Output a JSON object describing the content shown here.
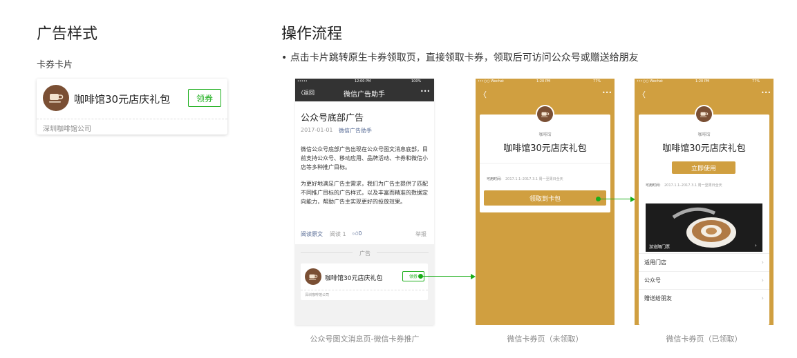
{
  "left": {
    "title": "广告样式",
    "subtitle": "卡券卡片",
    "card": {
      "name": "咖啡馆30元店庆礼包",
      "button": "领券",
      "company": "深圳咖啡馆公司"
    }
  },
  "right": {
    "title": "操作流程",
    "bullet": "•  点击卡片跳转原生卡券领取页，直接领取卡券，领取后可访问公众号或赠送给朋友"
  },
  "phone1": {
    "status_time": "12:00 PM",
    "status_battery": "100%",
    "nav_back": "〈返回",
    "nav_title": "微信广告助手",
    "nav_more": "•••",
    "article_title": "公众号底部广告",
    "article_date": "2017-01-01",
    "article_author": "微信广告助手",
    "para1": "微信公众号底部广告出现在公众号图文消息底部，目前支持公众号、移动应用、品牌活动、卡券和微信小店等多种推广目标。",
    "para2": "为更好地满足广告主需求，我们为广告主提供了匹配不同推广目标的广告样式，以及丰富而精准的数据定向能力，帮助广告主实现更好的投放效果。",
    "read_original": "阅读原文",
    "read_count": "阅读 1",
    "like_count": "0",
    "report": "举报",
    "ad_label": "广告",
    "card_name": "咖啡馆30元店庆礼包",
    "card_button": "领券",
    "card_company": "深圳咖啡馆公司",
    "caption": "公众号图文消息页-微信卡券推广"
  },
  "phone2": {
    "status_carrier": "•••○○ Wechat",
    "status_time": "1:20 PM",
    "status_battery": "77%",
    "back_icon": "〈",
    "more_icon": "•••",
    "shop": "咖啡馆",
    "name": "咖啡馆30元店庆礼包",
    "validity_label": "可用时间:",
    "validity_value": "2017.1.1–2017.3.1 周一至周日全天",
    "button": "领取到卡包",
    "caption": "微信卡券页（未领取）"
  },
  "phone3": {
    "status_carrier": "•••○○ Wechat",
    "status_time": "1:20 PM",
    "status_battery": "77%",
    "back_icon": "〈",
    "more_icon": "•••",
    "shop": "咖啡馆",
    "name": "咖啡馆30元店庆礼包",
    "button": "立即使用",
    "validity_label": "可用时间:",
    "validity_value": "2017.1.1–2017.3.1 周一至周日全天",
    "photo_label": "游览隔门票",
    "rows": [
      "适用门店",
      "公众号",
      "赠送给朋友"
    ],
    "caption": "微信卡券页（已领取）"
  },
  "colors": {
    "green": "#1aad19",
    "gold": "#d09f40",
    "coffee": "#7a4f34",
    "dark_bar": "#333333"
  }
}
